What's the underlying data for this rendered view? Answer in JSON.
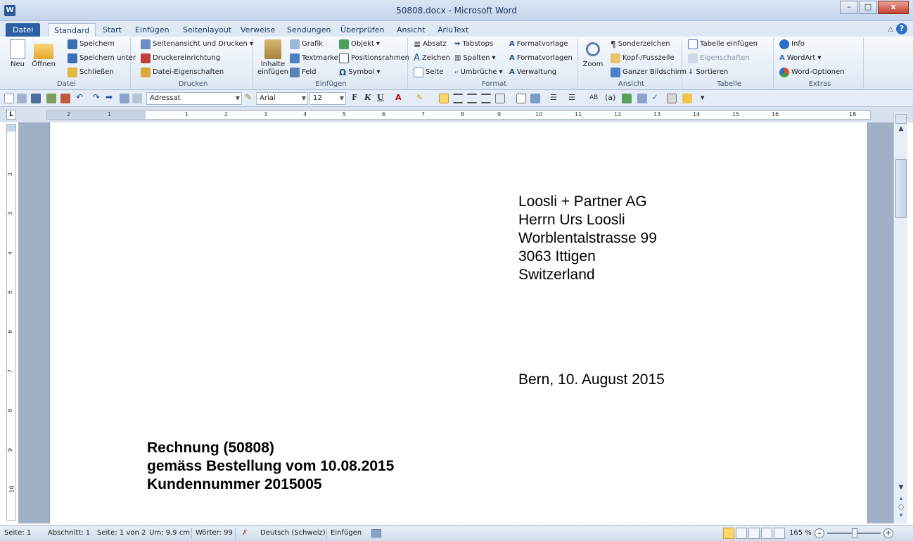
{
  "window": {
    "title": "50808.docx - Microsoft Word",
    "app_icon": "W",
    "minimize": "–",
    "maximize": "□",
    "close": "x"
  },
  "tabs": [
    "Datei",
    "Standard",
    "Start",
    "Einfügen",
    "Seitenlayout",
    "Verweise",
    "Sendungen",
    "Überprüfen",
    "Ansicht",
    "ArluText"
  ],
  "ribbon": {
    "datei": {
      "label": "Datei",
      "neu": "Neu",
      "oeffnen": "Öffnen",
      "speichern": "Speichern",
      "speichern_unter": "Speichern unter",
      "schliessen": "Schließen"
    },
    "drucken": {
      "label": "Drucken",
      "seitenansicht": "Seitenansicht und Drucken",
      "druckereinrichtung": "Druckereinrichtung",
      "datei_eigenschaften": "Datei-Eigenschaften"
    },
    "einfuegen": {
      "label": "Einfügen",
      "inhalte_1": "Inhalte",
      "inhalte_2": "einfügen",
      "grafik": "Grafik",
      "textmarke": "Textmarke",
      "feld": "Feld",
      "objekt": "Objekt",
      "positionsrahmen": "Positionsrahmen",
      "symbol": "Symbol"
    },
    "format": {
      "label": "Format",
      "absatz": "Absatz",
      "zeichen": "Zeichen",
      "seite": "Seite",
      "tabstops": "Tabstops",
      "spalten": "Spalten",
      "umbrueche": "Umbrüche",
      "formatvorlage": "Formatvorlage",
      "formatvorlagen": "Formatvorlagen",
      "verwaltung": "Verwaltung"
    },
    "ansicht": {
      "label": "Ansicht",
      "zoom": "Zoom",
      "sonderzeichen": "Sonderzeichen",
      "kopf_fusszeile": "Kopf-/Fusszeile",
      "ganzer_bildschirm": "Ganzer Bildschirm"
    },
    "tabelle": {
      "label": "Tabelle",
      "tabelle_einfuegen": "Tabelle einfügen",
      "eigenschaften": "Eigenschaften",
      "sortieren": "Sortieren"
    },
    "extras": {
      "label": "Extras",
      "info": "Info",
      "wordart": "WordArt",
      "word_optionen": "Word-Optionen"
    }
  },
  "toolbar": {
    "style_value": "Adressat",
    "font_value": "Arial",
    "size_value": "12",
    "bold": "F",
    "italic": "K",
    "underline": "U"
  },
  "ruler": {
    "numbers": [
      "2",
      "1",
      "1",
      "2",
      "3",
      "4",
      "5",
      "6",
      "7",
      "8",
      "9",
      "10",
      "11",
      "12",
      "13",
      "14",
      "15",
      "16",
      "18"
    ],
    "vnumbers": [
      "2",
      "3",
      "4",
      "5",
      "6",
      "7",
      "8",
      "9",
      "10",
      "11"
    ],
    "corner": "L"
  },
  "document": {
    "address": [
      "Loosli + Partner AG",
      "Herrn Urs Loosli",
      "Worblentalstrasse 99",
      "3063 Ittigen",
      "Switzerland"
    ],
    "date_line": "Bern, 10. August 2015",
    "subject": [
      "Rechnung (50808)",
      "gemäss Bestellung vom 10.08.2015",
      "Kundennummer 2015005"
    ]
  },
  "statusbar": {
    "seite": "Seite: 1",
    "abschnitt": "Abschnitt: 1",
    "seite_von": "Seite: 1 von 2",
    "um": "Um: 9.9 cm",
    "woerter": "Wörter: 99",
    "sprache": "Deutsch (Schweiz)",
    "modus": "Einfügen",
    "zoom": "165 %",
    "zoom_minus": "–",
    "zoom_plus": "+"
  },
  "colors": {
    "file_tab": "#2c5fa5",
    "ribbon_bg": "#dde8f4",
    "doc_bg": "#9fb0c7"
  }
}
